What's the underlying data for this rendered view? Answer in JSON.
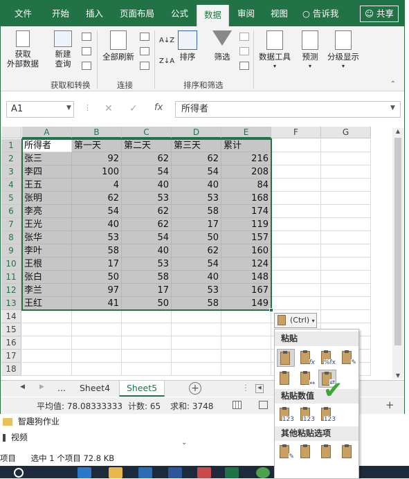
{
  "ribbon_tabs": [
    "文件",
    "开始",
    "插入",
    "页面布局",
    "公式",
    "数据",
    "审阅",
    "视图"
  ],
  "tell_me": "告诉我",
  "share": "共享",
  "ribbon": {
    "get_external": "获取\n外部数据",
    "new_query": "新建\n查询",
    "refresh_all": "全部刷新",
    "sort": "排序",
    "filter": "筛选",
    "data_tools": "数据工具",
    "forecast": "预测",
    "outline": "分级显示",
    "groups": [
      "获取和转换",
      "连接",
      "排序和筛选"
    ]
  },
  "formula_bar": {
    "name_box": "A1",
    "fx": "fx",
    "content": "所得者"
  },
  "columns": [
    "A",
    "B",
    "C",
    "D",
    "E",
    "F",
    "G"
  ],
  "rows": [
    "1",
    "2",
    "3",
    "4",
    "5",
    "6",
    "7",
    "8",
    "9",
    "10",
    "11",
    "12",
    "13",
    "14",
    "15",
    "16",
    "17",
    "18"
  ],
  "table": {
    "headers": [
      "所得者",
      "第一天",
      "第二天",
      "第三天",
      "累计"
    ],
    "data": [
      [
        "张三",
        "92",
        "62",
        "62",
        "216"
      ],
      [
        "李四",
        "100",
        "54",
        "54",
        "208"
      ],
      [
        "王五",
        "4",
        "40",
        "40",
        "84"
      ],
      [
        "张明",
        "62",
        "53",
        "53",
        "168"
      ],
      [
        "李亮",
        "54",
        "62",
        "58",
        "174"
      ],
      [
        "王光",
        "40",
        "62",
        "17",
        "119"
      ],
      [
        "张华",
        "53",
        "54",
        "50",
        "157"
      ],
      [
        "李叶",
        "58",
        "40",
        "62",
        "160"
      ],
      [
        "王根",
        "17",
        "53",
        "54",
        "124"
      ],
      [
        "张白",
        "50",
        "58",
        "40",
        "148"
      ],
      [
        "李兰",
        "97",
        "17",
        "53",
        "167"
      ],
      [
        "王红",
        "41",
        "50",
        "58",
        "149"
      ]
    ]
  },
  "sheets": [
    "...",
    "Sheet4",
    "Sheet5"
  ],
  "status": {
    "average": "平均值: 78.08333333",
    "count": "计数: 65",
    "sum": "求和: 3748"
  },
  "paste_options": {
    "button": "(Ctrl)",
    "paste": "粘贴",
    "paste_values": "粘贴数值",
    "other": "其他粘贴选项",
    "badge_123": "123"
  },
  "explorer": {
    "folder": "智趣狗作业",
    "video": "视频",
    "status_left": "项目",
    "status_selected": "选中 1 个项目 72.8 KB"
  },
  "colors": {
    "excel_green": "#217346",
    "check_green": "#3aa935"
  }
}
